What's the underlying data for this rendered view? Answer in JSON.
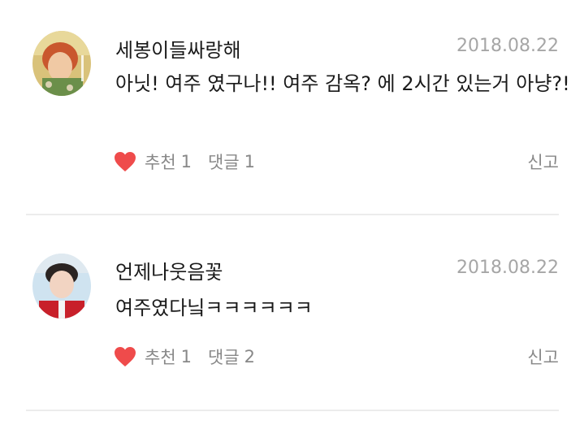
{
  "comments": [
    {
      "username": "세봉이들싸랑해",
      "date": "2018.08.22",
      "text": "아닛! 여주 였구나!! 여주 감옥? 에 2시간 있는거 아냥?!",
      "like_label": "추천",
      "like_count": "1",
      "reply_label": "댓글",
      "reply_count": "1",
      "report_label": "신고"
    },
    {
      "username": "언제나웃음꽃",
      "date": "2018.08.22",
      "text": "여주였다닠ㅋㅋㅋㅋㅋㅋ",
      "like_label": "추천",
      "like_count": "1",
      "reply_label": "댓글",
      "reply_count": "2",
      "report_label": "신고"
    }
  ],
  "colors": {
    "heart": "#ef4b4b",
    "meta_text": "#888888",
    "date_text": "#a6a6a6"
  },
  "icons": [
    "avatar-photo",
    "heart-icon"
  ]
}
